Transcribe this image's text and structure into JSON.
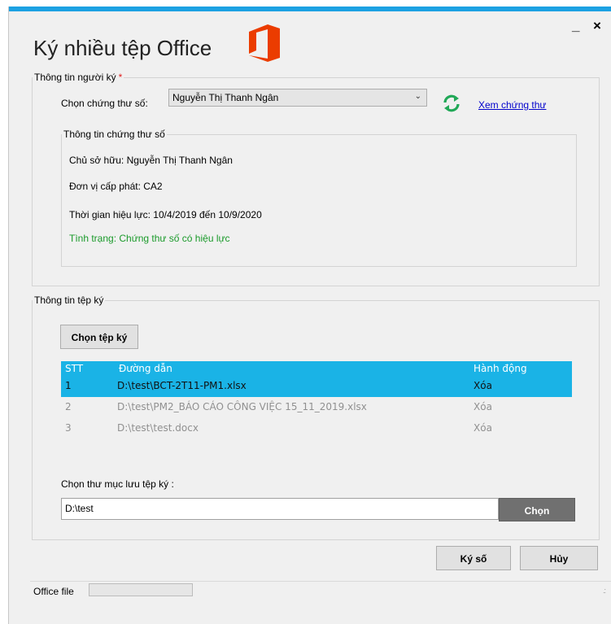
{
  "window": {
    "title": "Ký nhiều tệp Office",
    "min_label": "_",
    "close_label": "×"
  },
  "signer": {
    "legend": "Thông tin người ký",
    "required_mark": "*",
    "cert_label": "Chọn chứng thư số:",
    "cert_selected": "Nguyễn Thị Thanh Ngân",
    "view_cert_link": "Xem chứng thư",
    "info": {
      "legend": "Thông tin chứng thư số",
      "owner": "Chủ sở hữu: Nguyễn Thị Thanh Ngân",
      "issuer": "Đơn vị cấp phát: CA2",
      "validity": "Thời gian hiệu lực: 10/4/2019 đến 10/9/2020",
      "status": "Tình trạng: Chứng thư số có hiệu lực"
    }
  },
  "files": {
    "legend": "Thông tin tệp ký",
    "choose_button": "Chọn tệp ký",
    "columns": [
      "STT",
      "Đường dẫn",
      "Hành động"
    ],
    "rows": [
      {
        "no": "1",
        "path": "D:\\test\\BCT-2T11-PM1.xlsx",
        "action": "Xóa"
      },
      {
        "no": "2",
        "path": "D:\\test\\PM2_BÁO CÁO CÔNG VIỆC 15_11_2019.xlsx",
        "action": "Xóa"
      },
      {
        "no": "3",
        "path": "D:\\test\\test.docx",
        "action": "Xóa"
      }
    ],
    "selected_row": 0,
    "folder_label": "Chọn thư mục lưu tệp ký :",
    "folder_value": "D:\\test",
    "folder_button": "Chọn"
  },
  "actions": {
    "sign_button": "Ký số",
    "cancel_button": "Hủy"
  },
  "status_bar": {
    "label": "Office file",
    "grip": ".:"
  },
  "colors": {
    "accent": "#1da1e2",
    "selection": "#1ab3e6",
    "office_red": "#eb3c00",
    "ok_green": "#1a9a2a",
    "link": "#0000cc"
  }
}
